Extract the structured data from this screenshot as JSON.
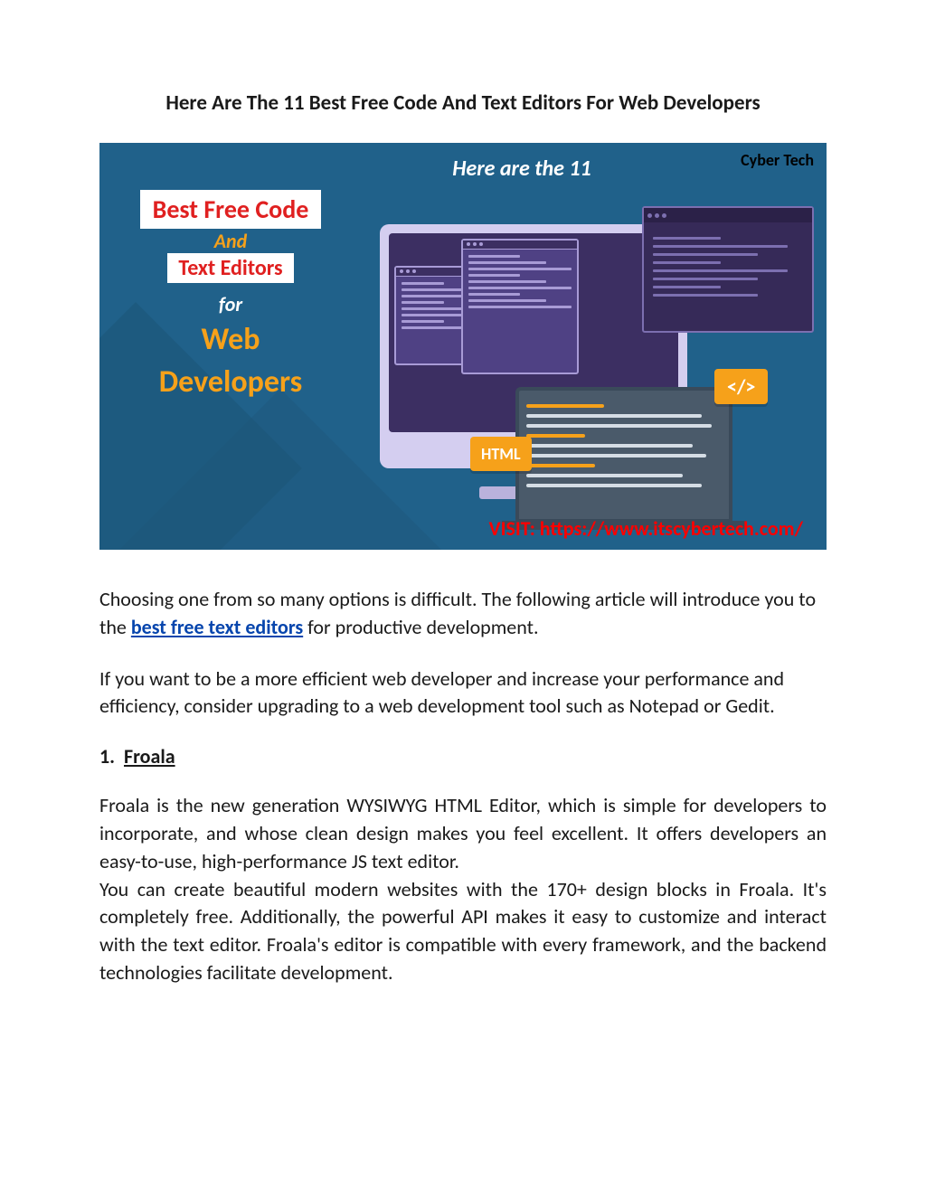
{
  "title": "Here Are The 11 Best Free Code And Text Editors For Web Developers",
  "banner": {
    "brand": "Cyber Tech",
    "header": "Here are the 11",
    "badge1": "Best Free Code",
    "and": "And",
    "badge2": "Text Editors",
    "for": "for",
    "web": "Web",
    "devs": "Developers",
    "html_tag": "HTML",
    "code_tag": "</>",
    "visit": "VISIT: https://www.itscybertech.com/"
  },
  "body": {
    "p1a": "Choosing one from so many options is difficult. The following article will introduce you to the ",
    "p1_link": "best free text editors",
    "p1b": " for productive development.",
    "p2": "If you want to be a more efficient web developer and increase your performance and efficiency, consider upgrading to a web development tool such as Notepad or Gedit.",
    "s1_num": "1.",
    "s1_title": "Froala",
    "s1_p1": "Froala is the new generation WYSIWYG HTML Editor, which is simple for developers to incorporate, and whose clean design makes you feel excellent. It offers developers an easy-to-use, high-performance JS text editor.",
    "s1_p2": "You can create beautiful modern websites with the 170+ design blocks in Froala. It's completely free. Additionally, the powerful API makes it easy to customize and interact with the text editor. Froala's editor is compatible with every framework, and the backend technologies facilitate development."
  }
}
